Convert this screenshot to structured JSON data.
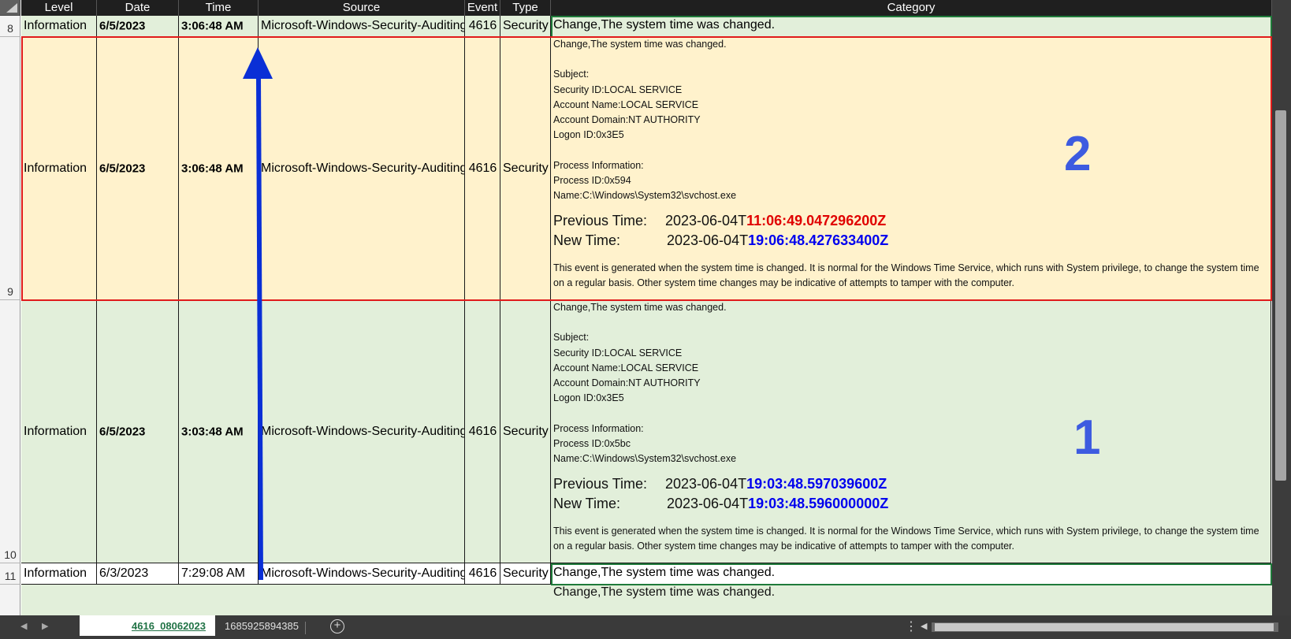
{
  "columns": [
    "Level",
    "Date",
    "Time",
    "Source",
    "Event",
    "Type",
    "Category"
  ],
  "rows": [
    {
      "num": "8",
      "level": "Information",
      "date": "6/5/2023",
      "time": "3:06:48 AM",
      "source": "Microsoft-Windows-Security-Auditing",
      "event": "4616",
      "type": "Security",
      "category": "Change,The system time was changed."
    },
    {
      "num": "9",
      "level": "Information",
      "date": "6/5/2023",
      "time": "3:06:48 AM",
      "source": "Microsoft-Windows-Security-Auditing",
      "event": "4616",
      "type": "Security",
      "detail": {
        "line1": "Change,The system time was changed.",
        "subject": "Subject:",
        "security_id": "Security ID:LOCAL SERVICE",
        "account_name": "Account Name:LOCAL SERVICE",
        "account_domain": "Account Domain:NT AUTHORITY",
        "logon_id": "Logon ID:0x3E5",
        "process_info": "Process Information:",
        "process_id": "Process ID:0x594",
        "process_name": "Name:C:\\Windows\\System32\\svchost.exe",
        "prev_label": "Previous Time:",
        "prev_date": "2023-06-04T",
        "prev_time": "11:06:49.047296200Z",
        "new_label": "New Time:",
        "new_date": "2023-06-04T",
        "new_time": "19:06:48.427633400Z",
        "description": "This event is generated when the system time is changed. It is normal for the Windows Time Service, which runs with System privilege, to change the system time on a regular basis. Other system time changes may be indicative of attempts to tamper with the computer."
      }
    },
    {
      "num": "10",
      "level": "Information",
      "date": "6/5/2023",
      "time": "3:03:48 AM",
      "source": "Microsoft-Windows-Security-Auditing",
      "event": "4616",
      "type": "Security",
      "detail": {
        "line1": "Change,The system time was changed.",
        "subject": "Subject:",
        "security_id": "Security ID:LOCAL SERVICE",
        "account_name": "Account Name:LOCAL SERVICE",
        "account_domain": "Account Domain:NT AUTHORITY",
        "logon_id": "Logon ID:0x3E5",
        "process_info": "Process Information:",
        "process_id": "Process ID:0x5bc",
        "process_name": "Name:C:\\Windows\\System32\\svchost.exe",
        "prev_label": "Previous Time:",
        "prev_date": "2023-06-04T",
        "prev_time": "19:03:48.597039600Z",
        "new_label": "New Time:",
        "new_date": "2023-06-04T",
        "new_time": "19:03:48.596000000Z",
        "description": "This event is generated when the system time is changed. It is normal for the Windows Time Service, which runs with System privilege, to change the system time on a regular basis. Other system time changes may be indicative of attempts to tamper with the computer."
      }
    },
    {
      "num": "11",
      "level": "Information",
      "date": "6/3/2023",
      "time": "7:29:08 AM",
      "source": "Microsoft-Windows-Security-Auditing",
      "event": "4616",
      "type": "Security",
      "category": "Change,The system time was changed."
    }
  ],
  "annotations": {
    "label_2": "2",
    "label_1": "1",
    "arrow_color": "#0a2fd6"
  },
  "overflow_text": "Change,The system time was changed.",
  "sheet_tabs": {
    "active": "4616_08062023",
    "second": "1685925894385"
  },
  "icons": {
    "prev": "chevron-left-icon",
    "next": "chevron-right-icon",
    "add": "plus-circle-icon",
    "more": "kebab-icon"
  },
  "colors": {
    "green_row": "#e2efda",
    "orange_row": "#fff2cc",
    "red_time": "#e00000",
    "blue_time": "#0000ee",
    "label_blue": "#3d5be0"
  }
}
